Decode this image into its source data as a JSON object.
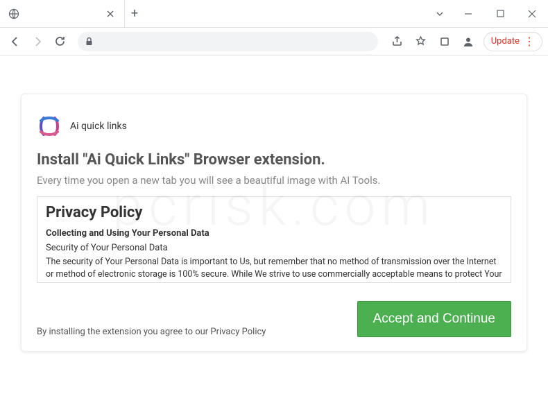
{
  "browser": {
    "tab_title": "",
    "new_tab_label": "+",
    "update_label": "Update"
  },
  "card": {
    "logo_text": "Ai quick links",
    "title": "Install \"Ai Quick Links\" Browser extension.",
    "subtitle": "Every time you open a new tab you will see a beautiful image with AI Tools.",
    "agree_text": "By installing the extension you agree to our Privacy Policy",
    "accept_label": "Accept and Continue"
  },
  "policy": {
    "title": "Privacy Policy",
    "section_heading": "Collecting and Using Your Personal Data",
    "subsection": "Security of Your Personal Data",
    "body": "The security of Your Personal Data is important to Us, but remember that no method of transmission over the Internet or method of electronic storage is 100% secure. While We strive to use commercially acceptable means to protect Your Personal Data, We cannot guarantee its absolute security."
  }
}
